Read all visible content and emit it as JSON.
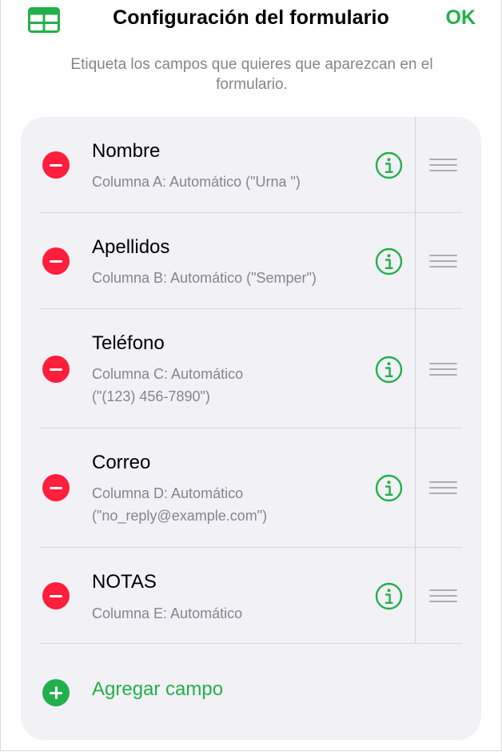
{
  "header": {
    "title": "Configuración del formulario",
    "ok_label": "OK",
    "icon": "table-icon",
    "accent_color": "#22b04a"
  },
  "subtitle": "Etiqueta los campos que quieres que aparezcan en el formulario.",
  "fields": [
    {
      "name": "Nombre",
      "detail": [
        "Columna A: Automático (\"Urna \")"
      ]
    },
    {
      "name": "Apellidos",
      "detail": [
        "Columna B: Automático (\"Semper\")"
      ]
    },
    {
      "name": "Teléfono",
      "detail": [
        "Columna C: Automático",
        "(\"(123) 456-7890\")"
      ]
    },
    {
      "name": "Correo",
      "detail": [
        "Columna D: Automático",
        "(\"no_reply@example.com\")"
      ]
    },
    {
      "name": "NOTAS",
      "detail": [
        "Columna E: Automático"
      ]
    }
  ],
  "icons": {
    "remove": "minus-circle-icon",
    "info": "info-circle-icon",
    "reorder": "drag-handle-icon",
    "add": "plus-circle-icon"
  },
  "colors": {
    "remove": "#ff1e3c",
    "secondary_text": "#85858b",
    "card_background": "#f1f1f6"
  },
  "add_field_label": "Agregar campo"
}
